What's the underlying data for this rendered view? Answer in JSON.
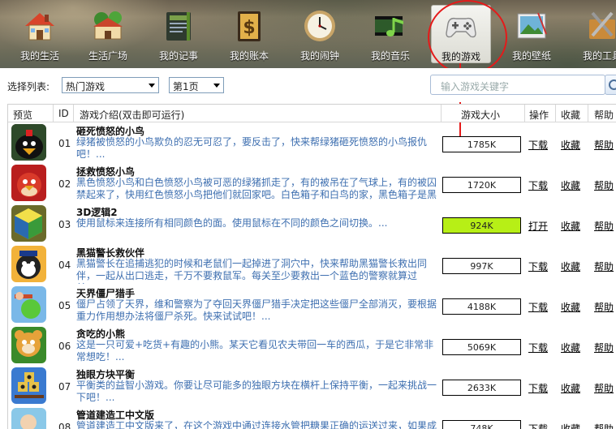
{
  "toolbar": {
    "items": [
      {
        "label": "我的生活",
        "icon": "house-icon"
      },
      {
        "label": "生活广场",
        "icon": "village-icon"
      },
      {
        "label": "我的记事",
        "icon": "notebook-icon"
      },
      {
        "label": "我的账本",
        "icon": "ledger-icon"
      },
      {
        "label": "我的闹钟",
        "icon": "clock-icon"
      },
      {
        "label": "我的音乐",
        "icon": "music-icon"
      },
      {
        "label": "我的游戏",
        "icon": "gamepad-icon"
      },
      {
        "label": "我的壁纸",
        "icon": "wallpaper-icon"
      },
      {
        "label": "我的工具",
        "icon": "tools-icon"
      }
    ],
    "active_index": 6
  },
  "filter": {
    "label": "选择列表:",
    "list_value": "热门游戏",
    "page_value": "第1页",
    "search_placeholder": "输入游戏关键字"
  },
  "table": {
    "headers": {
      "preview": "预览",
      "id": "ID",
      "intro": "游戏介绍(双击即可运行)",
      "size": "游戏大小",
      "operation": "操作",
      "favorite": "收藏",
      "help": "帮助"
    },
    "rows": [
      {
        "id": "01",
        "title": "砸死愤怒的小鸟",
        "desc": "绿猪被愤怒的小鸟欺负的忍无可忍了，要反击了，快来帮绿猪砸死愤怒的小鸟报仇吧！...",
        "size": "1785K",
        "action": "下载",
        "fav": "收藏",
        "help": "帮助",
        "downloaded": false
      },
      {
        "id": "02",
        "title": "拯救愤怒小鸟",
        "desc": "黑色愤怒小鸟和白色愤怒小鸟被可恶的绿猪抓走了，有的被吊在了气球上，有的被囚禁起来了，快用红色愤怒小鸟把他们就回家吧。白色箱子和白鸟的家，黑色箱子是黑",
        "size": "1720K",
        "action": "下载",
        "fav": "收藏",
        "help": "帮助",
        "downloaded": false
      },
      {
        "id": "03",
        "title": "3D逻辑2",
        "desc": "使用鼠标来连接所有相同颜色的面。使用鼠标在不同的颜色之间切换。...",
        "size": "924K",
        "action": "打开",
        "fav": "收藏",
        "help": "帮助",
        "downloaded": true
      },
      {
        "id": "04",
        "title": "黑猫警长救伙伴",
        "desc": "黑猫警长在追捕逃犯的时候和老鼠们一起掉进了洞穴中，快来帮助黑猫警长救出同伴，一起从出口逃走，千万不要救鼠军。每关至少要救出一个蓝色的警察就算过关。...",
        "size": "997K",
        "action": "下载",
        "fav": "收藏",
        "help": "帮助",
        "downloaded": false
      },
      {
        "id": "05",
        "title": "天界僵尸猎手",
        "desc": "僵尸占领了天界，维和警察为了夺回天界僵尸猎手决定把这些僵尸全部消灭，要根据重力作用想办法将僵尸杀死。快来试试吧！...",
        "size": "4188K",
        "action": "下载",
        "fav": "收藏",
        "help": "帮助",
        "downloaded": false
      },
      {
        "id": "06",
        "title": "贪吃的小熊",
        "desc": "这是一只可爱+吃货+有趣的小熊。某天它看见农夫带回一车的西瓜，于是它非常非常想吃！...",
        "size": "5069K",
        "action": "下载",
        "fav": "收藏",
        "help": "帮助",
        "downloaded": false
      },
      {
        "id": "07",
        "title": "独眼方块平衡",
        "desc": "平衡类的益智小游戏。你要让尽可能多的独眼方块在横杆上保持平衡，一起来挑战一下吧！...",
        "size": "2633K",
        "action": "下载",
        "fav": "收藏",
        "help": "帮助",
        "downloaded": false
      },
      {
        "id": "08",
        "title": "管道建造工中文版",
        "desc": "管道建造工中文版来了，在这个游戏中通过连接水管把糖果正确的运送过来，如果成功",
        "size": "748K",
        "action": "下载",
        "fav": "收藏",
        "help": "帮助",
        "downloaded": false
      }
    ]
  },
  "colors": {
    "annotation": "#e51a1a",
    "desc_text": "#3e6fb0",
    "downloaded_fill": "#b7ef16"
  }
}
